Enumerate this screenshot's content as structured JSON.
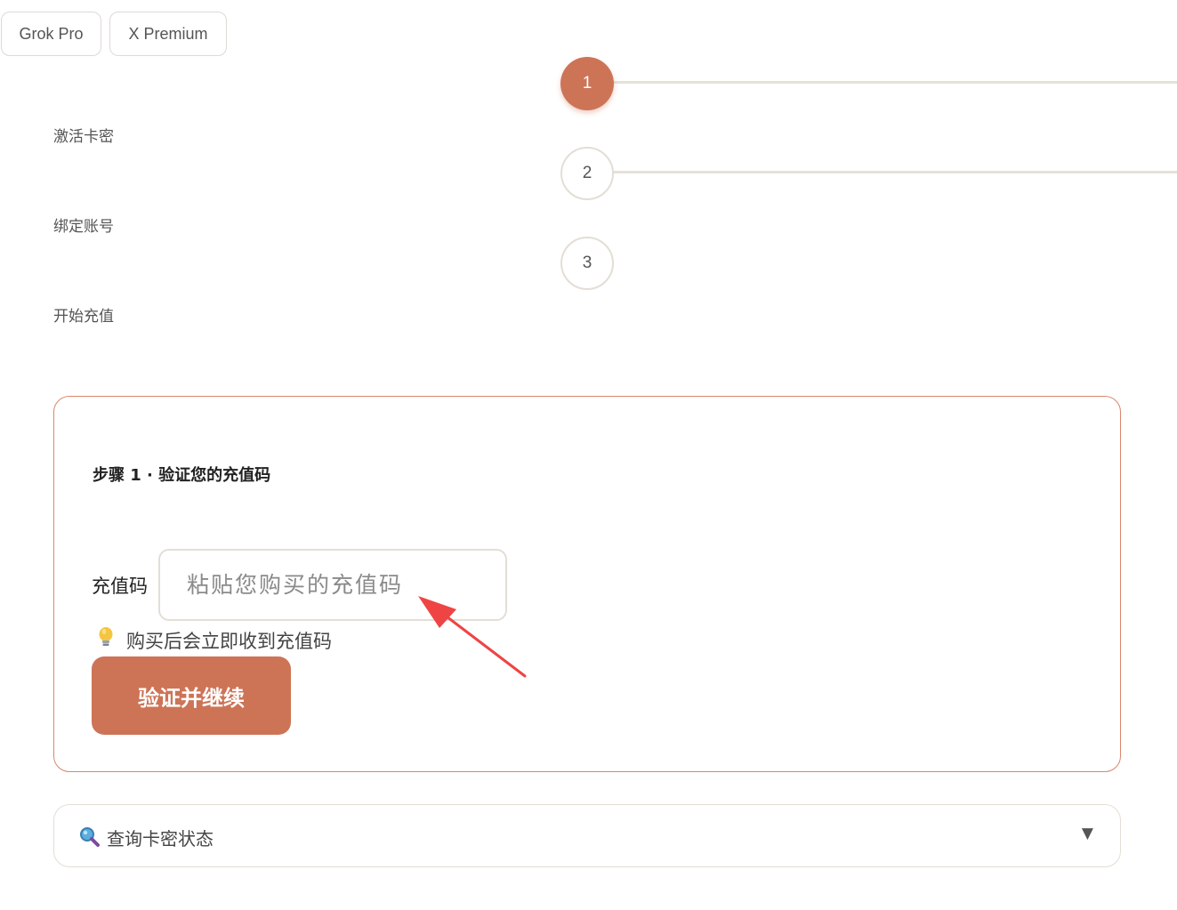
{
  "tabs": [
    {
      "label": "Grok Pro"
    },
    {
      "label": "X Premium"
    }
  ],
  "steps": [
    {
      "number": "1",
      "label": "激活卡密",
      "state": "active"
    },
    {
      "number": "2",
      "label": "绑定账号",
      "state": "inactive"
    },
    {
      "number": "3",
      "label": "开始充值",
      "state": "inactive"
    }
  ],
  "card": {
    "title": "步骤 1 · 验证您的充值码",
    "field_label": "充值码",
    "input_value": "",
    "input_placeholder": "粘贴您购买的充值码",
    "hint_icon": "lightbulb-icon",
    "hint_text": "购买后会立即收到充值码",
    "button_label": "验证并继续"
  },
  "query": {
    "icon": "magnifier-icon",
    "label": "查询卡密状态",
    "caret_icon": "caret-down-icon"
  },
  "colors": {
    "accent": "#cd7457",
    "card_border": "#d9866b",
    "annotation_arrow": "#ef4444"
  }
}
